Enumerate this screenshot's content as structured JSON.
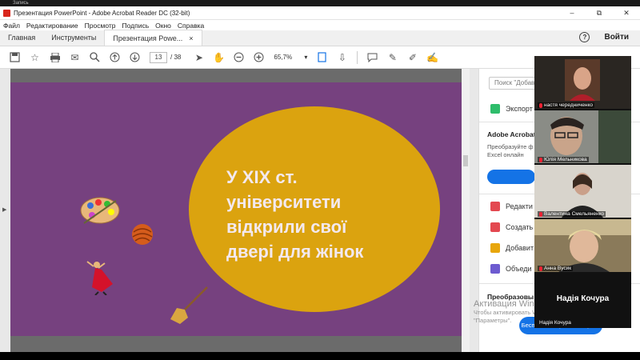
{
  "recording_label": "Запись",
  "window": {
    "title": "Презентация PowerPoint - Adobe Acrobat Reader DC (32-bit)",
    "minimize": "–",
    "maximize": "⧉",
    "close": "✕"
  },
  "menu": [
    "Файл",
    "Редактирование",
    "Просмотр",
    "Подпись",
    "Окно",
    "Справка"
  ],
  "tabs": {
    "home": "Главная",
    "tools": "Инструменты",
    "document": "Презентация Powe...",
    "document_close": "×",
    "help": "?",
    "signin": "Войти"
  },
  "toolbar": {
    "page_current": "13",
    "page_separator": "/",
    "page_total": "38",
    "zoom": "65,7%",
    "zoom_arrow": "▾"
  },
  "slide": {
    "text": "У XIX ст.\nуніверситети\nвідкрили свої\nдвері для жінок",
    "colors": {
      "background": "#76417f",
      "oval": "#dba30f"
    }
  },
  "right_panel": {
    "search_placeholder": "Поиск \"Добав",
    "export_label": "Экспорт",
    "heading": "Adobe Acrobat",
    "sub1": "Преобразуйте ф",
    "sub2": "Excel онлайн",
    "items": [
      "Редакти",
      "Создать",
      "Добавит",
      "Объеди"
    ],
    "convert_label": "Преобразовы",
    "free_button": "Бесплатная пробная версия"
  },
  "watermark": {
    "line1": "Активация Windows",
    "line2": "Чтобы активировать Windows, перейдите в раздел",
    "line3": "\"Параметры\"."
  },
  "video_call": {
    "participants": [
      {
        "name": "настя чередниченко"
      },
      {
        "name": "Юлія Мельникова"
      },
      {
        "name": "Валентина Смельяненко"
      },
      {
        "name": "Анна Вусик"
      }
    ],
    "active_speaker": {
      "display": "Надія Кочура",
      "label": "Надія Кочура"
    }
  }
}
